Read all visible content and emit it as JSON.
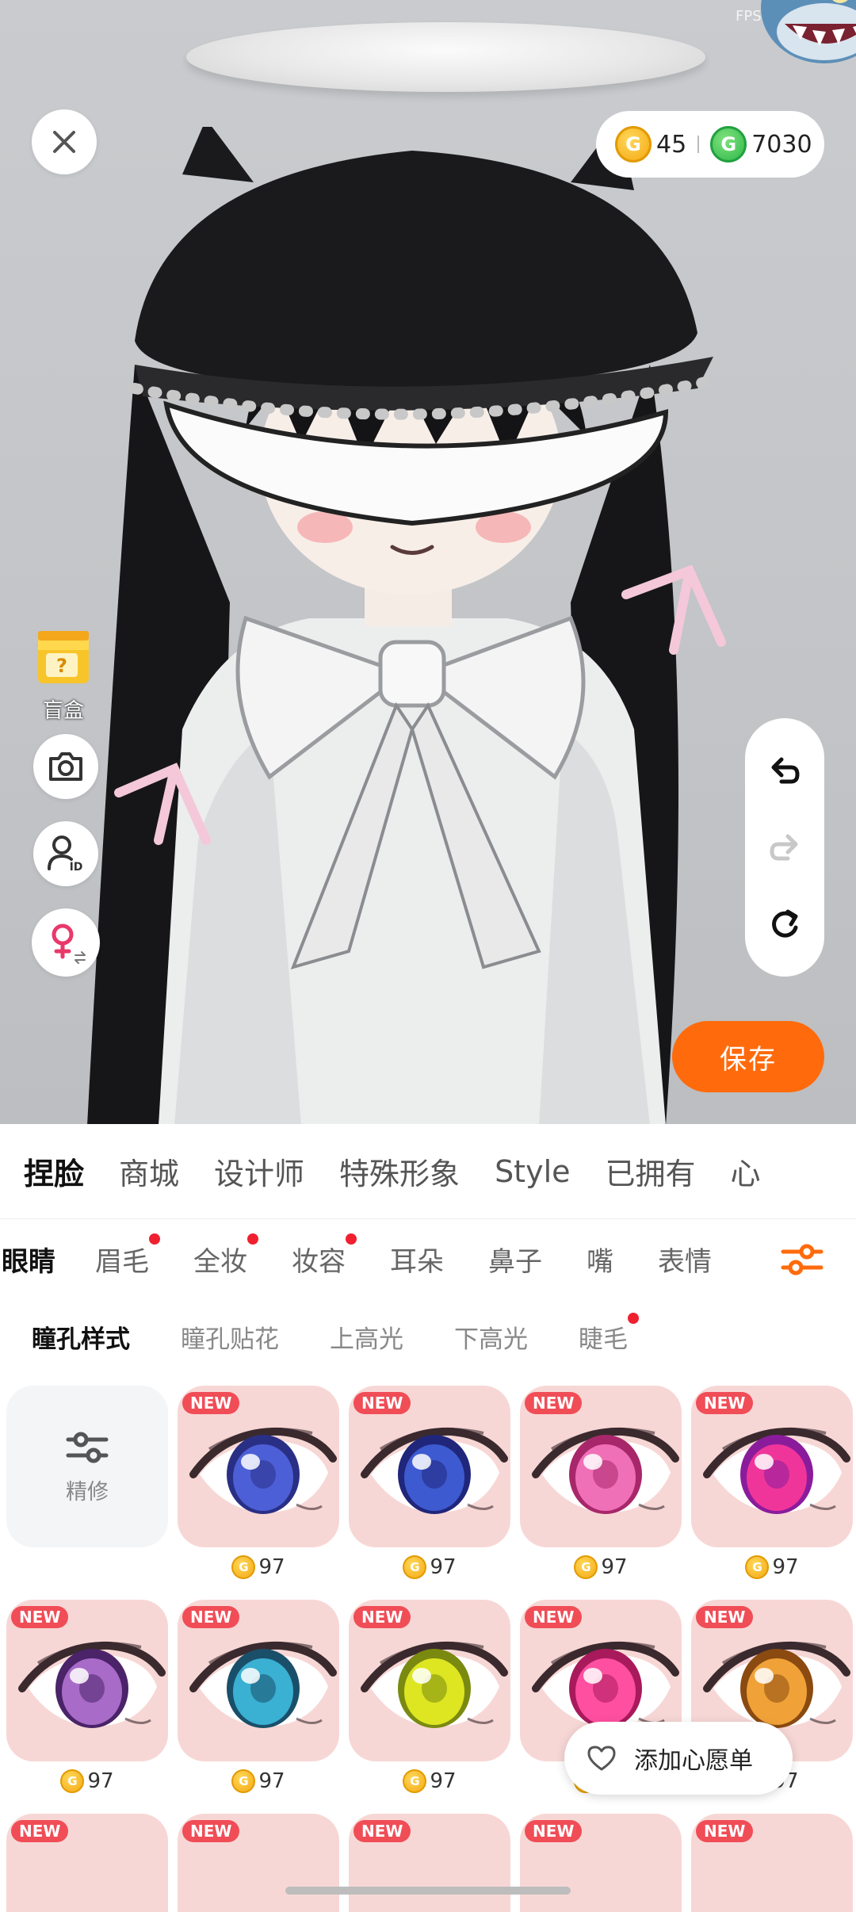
{
  "status": {
    "fps_label": "FPS"
  },
  "currency": {
    "gold_amount": "45",
    "gold_symbol": "G",
    "green_amount": "7030",
    "green_symbol": "G"
  },
  "left_tools": {
    "blindbox_label": "盲盒",
    "blindbox_symbol": "?"
  },
  "save": {
    "label": "保存"
  },
  "main_tabs": [
    {
      "label": "捏脸",
      "active": true
    },
    {
      "label": "商城"
    },
    {
      "label": "设计师"
    },
    {
      "label": "特殊形象"
    },
    {
      "label": "Style"
    },
    {
      "label": "已拥有"
    },
    {
      "label": "心"
    }
  ],
  "sub_tabs": [
    {
      "label": "眼睛",
      "active": true
    },
    {
      "label": "眉毛",
      "dot": true
    },
    {
      "label": "全妆",
      "dot": true
    },
    {
      "label": "妆容",
      "dot": true
    },
    {
      "label": "耳朵"
    },
    {
      "label": "鼻子"
    },
    {
      "label": "嘴"
    },
    {
      "label": "表情"
    }
  ],
  "third_tabs": [
    {
      "label": "瞳孔样式",
      "active": true
    },
    {
      "label": "瞳孔贴花"
    },
    {
      "label": "上高光"
    },
    {
      "label": "下高光"
    },
    {
      "label": "睫毛",
      "dot": true
    }
  ],
  "grid": {
    "refine_label": "精修",
    "new_badge": "NEW",
    "coin_symbol": "G",
    "items": [
      {
        "price": "97",
        "iris": "#4d5fd6",
        "iris_dark": "#2a2f86"
      },
      {
        "price": "97",
        "iris": "#3d5ad0",
        "iris_dark": "#20267a"
      },
      {
        "price": "97",
        "iris": "#f070b8",
        "iris_dark": "#a8276a"
      },
      {
        "price": "97",
        "iris": "#f0359a",
        "iris_dark": "#8a1c9c"
      },
      {
        "price": "97",
        "iris": "#a86bc8",
        "iris_dark": "#4a2368"
      },
      {
        "price": "97",
        "iris": "#3ab0d2",
        "iris_dark": "#1a4f6a"
      },
      {
        "price": "97",
        "iris": "#dde621",
        "iris_dark": "#7a8a10"
      },
      {
        "price": "97",
        "iris": "#ff4fa0",
        "iris_dark": "#a81a5c"
      },
      {
        "price": "97",
        "iris": "#f0a238",
        "iris_dark": "#8a4a10"
      }
    ]
  },
  "wishlist": {
    "label": "添加心愿单"
  },
  "colors": {
    "accent": "#ff6b0c",
    "badge_red": "#f04d57",
    "dot_red": "#f02030"
  }
}
